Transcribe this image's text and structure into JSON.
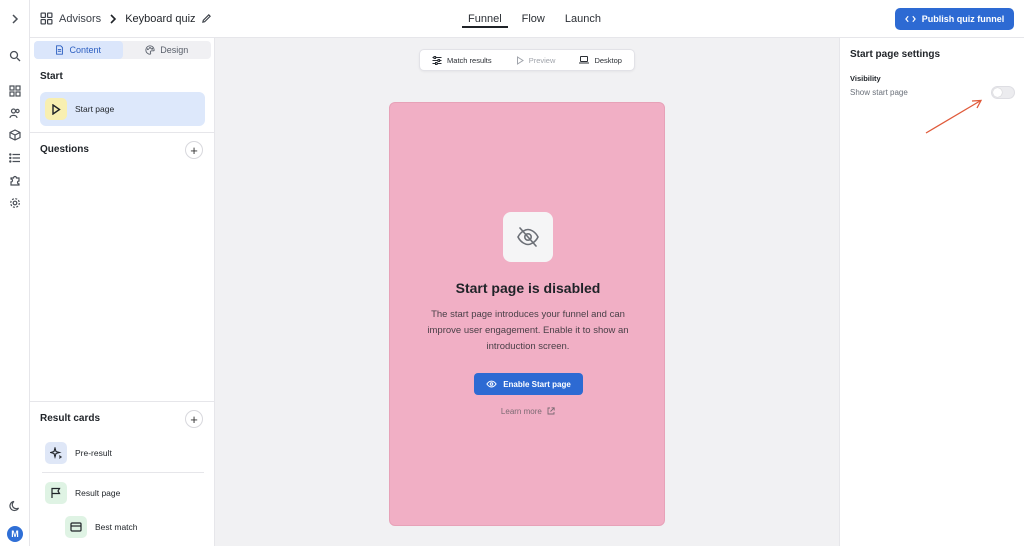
{
  "breadcrumb": {
    "root": "Advisors",
    "current": "Keyboard quiz"
  },
  "top_tabs": [
    "Funnel",
    "Flow",
    "Launch"
  ],
  "publish_label": "Publish quiz funnel",
  "left_panel": {
    "seg_content": "Content",
    "seg_design": "Design",
    "start_heading": "Start",
    "start_item": "Start page",
    "questions_heading": "Questions",
    "result_heading": "Result cards",
    "results": [
      "Pre-result",
      "Result page",
      "Best match"
    ]
  },
  "toolbar": {
    "match": "Match results",
    "preview": "Preview",
    "desktop": "Desktop"
  },
  "card": {
    "title": "Start page is disabled",
    "body": "The start page introduces your funnel and can improve user engagement. Enable it to show an introduction screen.",
    "enable_label": "Enable Start page",
    "learn_more": "Learn more"
  },
  "settings": {
    "title": "Start page settings",
    "label": "Visibility",
    "sub": "Show start page",
    "toggle_on": false
  },
  "avatar_initial": "M",
  "colors": {
    "accent": "#2d6ad3",
    "card_bg": "#f1afc5",
    "annotation": "#e05a3a"
  }
}
